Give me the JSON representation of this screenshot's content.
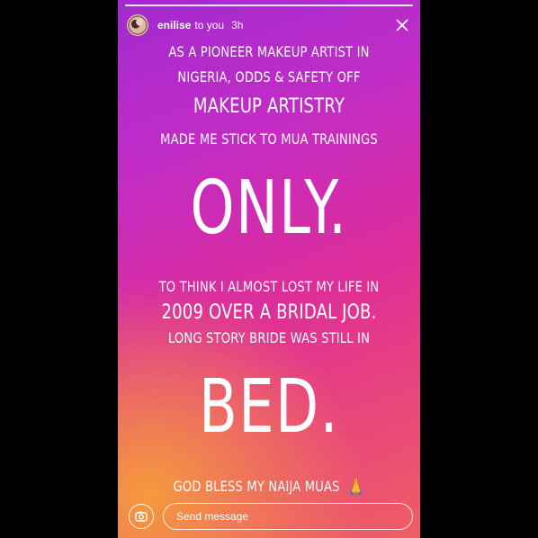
{
  "header": {
    "username": "enilise",
    "recipient": "to you",
    "time": "3h"
  },
  "story_lines": {
    "line1": "AS A PIONEER MAKEUP ARTIST IN",
    "line2": "NIGERIA, ODDS & SAFETY OFF",
    "line3": "MAKEUP ARTISTRY",
    "line4": "MADE ME STICK TO MUA TRAININGS",
    "line5": "ONLY.",
    "line6": "TO THINK I ALMOST LOST MY LIFE IN",
    "line7": "2009 OVER A BRIDAL JOB.",
    "line8": "LONG STORY BRIDE WAS STILL IN",
    "line9": "BED.",
    "line10": "GOD BLESS MY NAIJA MUAS",
    "emoji": "🙏"
  },
  "bottom_bar": {
    "message_placeholder": "Send message"
  },
  "icons": {
    "close": "close-icon",
    "camera": "camera-icon",
    "avatar": "avatar"
  },
  "colors": {
    "background": "#000000",
    "gradient_top": "#a22ad0",
    "gradient_mid": "#dd2d9a",
    "gradient_bottom": "#ee5f63",
    "accent": "#f59a3d",
    "text": "#ffffff"
  }
}
